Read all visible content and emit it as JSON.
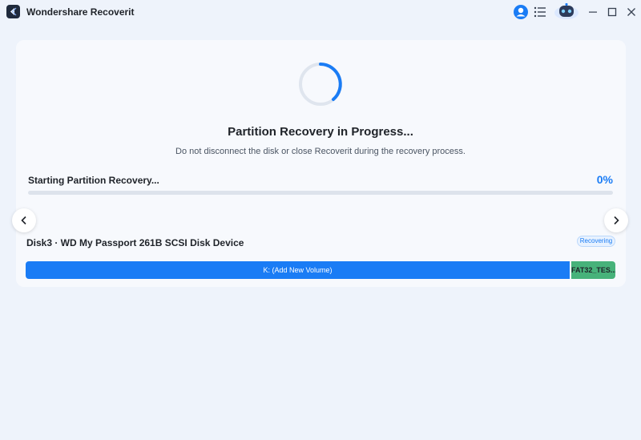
{
  "app": {
    "title": "Wondershare Recoverit"
  },
  "titlebar": {
    "icons": [
      "user-icon",
      "list-icon",
      "assistant-bot-icon",
      "minimize-icon",
      "maximize-icon",
      "close-icon"
    ]
  },
  "recovery": {
    "heading": "Partition Recovery in Progress...",
    "subtext": "Do not disconnect the disk or close Recoverit during the recovery process.",
    "progress_label": "Starting Partition Recovery...",
    "progress_percent": "0%",
    "progress_value": 0
  },
  "disk": {
    "name": "Disk3 · WD My Passport 261B SCSI Disk Device",
    "status": "Recovering",
    "partitions": [
      {
        "label": "K: (Add New Volume)",
        "color": "#1a7cf5"
      },
      {
        "label": "FAT32_TES...",
        "color": "#47b27a"
      }
    ]
  },
  "colors": {
    "accent": "#1a7cf5",
    "partition_green": "#47b27a",
    "background": "#eef3fb"
  }
}
